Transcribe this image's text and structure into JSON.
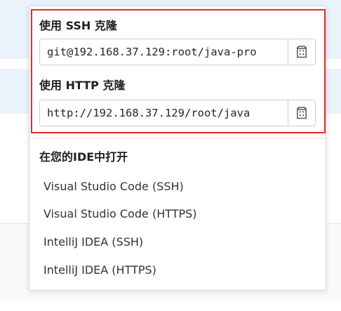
{
  "clone": {
    "ssh_label": "使用 SSH 克隆",
    "ssh_url": "git@192.168.37.129:root/java-pro",
    "http_label": "使用 HTTP 克隆",
    "http_url": "http://192.168.37.129/root/java"
  },
  "ide": {
    "title": "在您的IDE中打开",
    "items": [
      "Visual Studio Code (SSH)",
      "Visual Studio Code (HTTPS)",
      "IntelliJ IDEA (SSH)",
      "IntelliJ IDEA (HTTPS)"
    ]
  },
  "icons": {
    "copy": "clipboard-copy-icon"
  },
  "colors": {
    "highlight": "#e8282e",
    "page_band": "#eaf2fb"
  }
}
